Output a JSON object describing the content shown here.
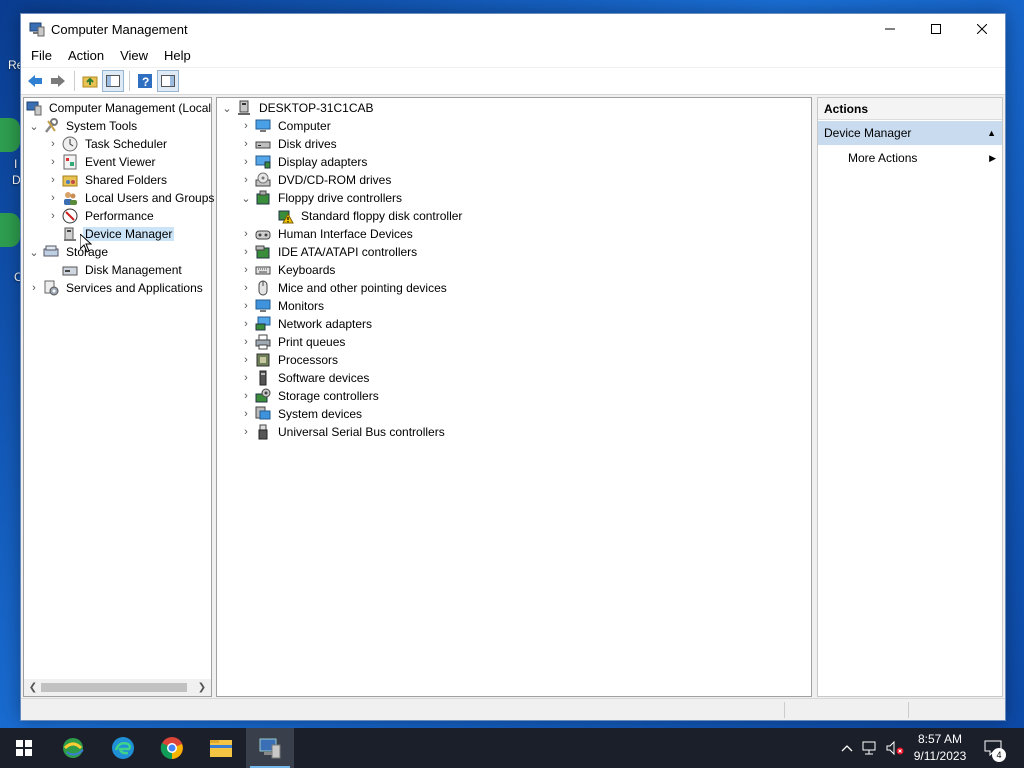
{
  "desktop": {
    "fragments": [
      "Re",
      "I",
      "D",
      "C"
    ]
  },
  "window": {
    "title": "Computer Management",
    "menu": [
      "File",
      "Action",
      "View",
      "Help"
    ]
  },
  "left_tree": {
    "root": "Computer Management (Local",
    "system_tools": "System Tools",
    "task_scheduler": "Task Scheduler",
    "event_viewer": "Event Viewer",
    "shared_folders": "Shared Folders",
    "local_users": "Local Users and Groups",
    "performance": "Performance",
    "device_manager": "Device Manager",
    "storage": "Storage",
    "disk_management": "Disk Management",
    "services": "Services and Applications"
  },
  "device_tree": {
    "host": "DESKTOP-31C1CAB",
    "categories": [
      "Computer",
      "Disk drives",
      "Display adapters",
      "DVD/CD-ROM drives",
      "Floppy drive controllers",
      "Human Interface Devices",
      "IDE ATA/ATAPI controllers",
      "Keyboards",
      "Mice and other pointing devices",
      "Monitors",
      "Network adapters",
      "Print queues",
      "Processors",
      "Software devices",
      "Storage controllers",
      "System devices",
      "Universal Serial Bus controllers"
    ],
    "floppy_child": "Standard floppy disk controller"
  },
  "actions": {
    "header": "Actions",
    "section": "Device Manager",
    "more": "More Actions"
  },
  "taskbar": {
    "time": "8:57 AM",
    "date": "9/11/2023",
    "notifications": "4"
  },
  "colors": {
    "selection": "#cce4f7",
    "actions_section": "#c9dbef",
    "taskbar": "#1b1f2a"
  }
}
